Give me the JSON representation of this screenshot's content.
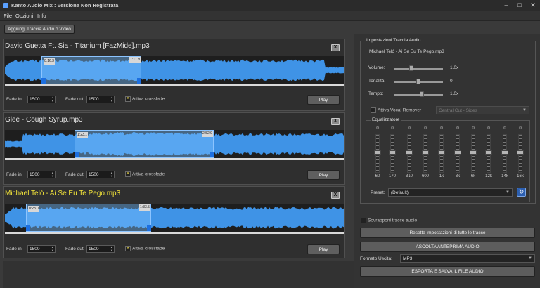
{
  "window": {
    "title": "Kanto Audio Mix : Versione Non Registrata",
    "minimize": "–",
    "restore": "□",
    "close": "✕"
  },
  "menu": [
    "File",
    "Opzioni",
    "Info"
  ],
  "add_button": "Aggiungi Traccia Audio o Video",
  "tracks": [
    {
      "name": "David Guetta Ft. Sia - Titanium [FazMide].mp3",
      "selected": false,
      "start_marker": "0:16.3",
      "end_marker": "1:11.9",
      "fade_in_label": "Fade in:",
      "fade_in": "1500",
      "fade_out_label": "Fade out:",
      "fade_out": "1500",
      "crossfade": "Attiva crossfade",
      "play": "Play",
      "close": "X"
    },
    {
      "name": "Glee - Cough Syrup.mp3",
      "selected": false,
      "start_marker": "1:23.1",
      "end_marker": "2:52.9",
      "fade_in_label": "Fade in:",
      "fade_in": "1500",
      "fade_out_label": "Fade out:",
      "fade_out": "1500",
      "crossfade": "Attiva crossfade",
      "play": "Play",
      "close": "X"
    },
    {
      "name": "Michael Teló - Ai Se Eu Te Pego.mp3",
      "selected": true,
      "start_marker": "0:28.0",
      "end_marker": "1:33.5",
      "fade_in_label": "Fade in:",
      "fade_in": "1500",
      "fade_out_label": "Fade out:",
      "fade_out": "1500",
      "crossfade": "Attiva crossfade",
      "play": "Play",
      "close": "X"
    }
  ],
  "settings": {
    "legend": "Impostazioni Traccia Audio",
    "track_name": "Michael Teló - Ai Se Eu Te Pego.mp3",
    "volume_label": "Volume:",
    "volume_value": "1.0x",
    "pitch_label": "Tonalità:",
    "pitch_value": "0",
    "tempo_label": "Tempo:",
    "tempo_value": "1.0x",
    "vocal_remover_label": "Attiva Vocal Remover",
    "vocal_remover_option": "Central Cut - Sides",
    "eq_legend": "Equalizzatore",
    "eq_values": [
      "0",
      "0",
      "0",
      "0",
      "0",
      "0",
      "0",
      "0",
      "0",
      "0"
    ],
    "eq_freqs": [
      "60",
      "170",
      "310",
      "600",
      "1k",
      "3k",
      "6k",
      "12k",
      "14k",
      "16k"
    ],
    "preset_label": "Preset:",
    "preset_value": "(Default)"
  },
  "overlap_label": "Sovrapponi tracce audio",
  "reset_button": "Resetta impostazioni di tutte le tracce",
  "preview_button": "ASCOLTA ANTEPRIMA AUDIO",
  "output_format_label": "Formato Uscita:",
  "output_format_value": "MP3",
  "export_button": "ESPORTA E SALVA IL FILE AUDIO",
  "colors": {
    "accent": "#2e86de",
    "selected_track": "#f2e33a",
    "waveform": "#3f93e6"
  }
}
